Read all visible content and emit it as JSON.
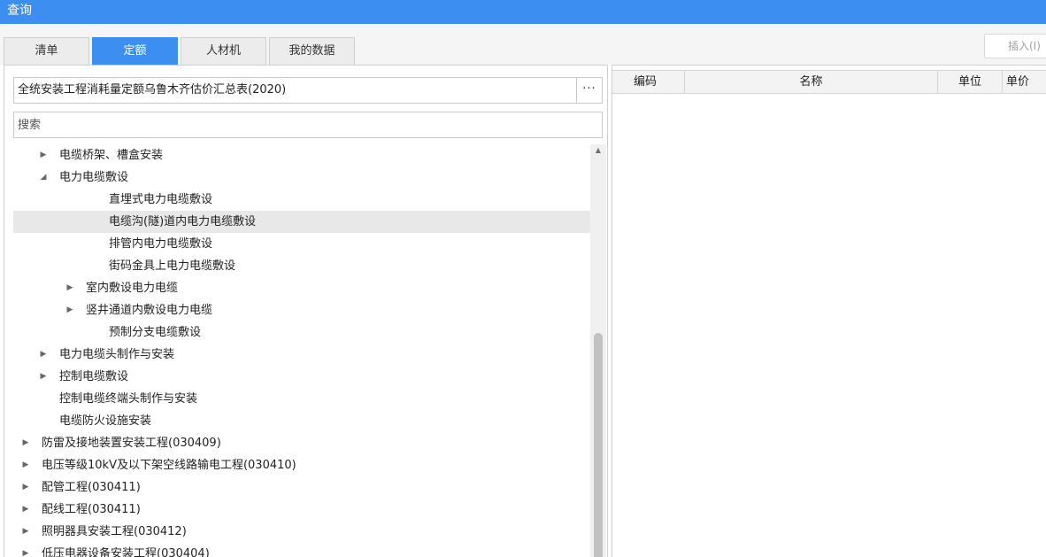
{
  "window": {
    "title": "查询"
  },
  "tabs": [
    {
      "label": "清单",
      "active": false
    },
    {
      "label": "定额",
      "active": true
    },
    {
      "label": "人材机",
      "active": false
    },
    {
      "label": "我的数据",
      "active": false
    }
  ],
  "toolbar": {
    "insert_label": "插入(I)"
  },
  "library": {
    "name": "全统安装工程消耗量定额乌鲁木齐估价汇总表(2020)",
    "more_label": "···"
  },
  "search": {
    "placeholder": "搜索",
    "value": ""
  },
  "tree": [
    {
      "label": "电缆桥架、槽盒安装",
      "level": 2,
      "state": "collapsed",
      "selected": false
    },
    {
      "label": "电力电缆敷设",
      "level": 2,
      "state": "expanded",
      "selected": false
    },
    {
      "label": "直埋式电力电缆敷设",
      "level": 3,
      "state": "leaf",
      "selected": false
    },
    {
      "label": "电缆沟(隧)道内电力电缆敷设",
      "level": 3,
      "state": "leaf",
      "selected": true
    },
    {
      "label": "排管内电力电缆敷设",
      "level": 3,
      "state": "leaf",
      "selected": false
    },
    {
      "label": "街码金具上电力电缆敷设",
      "level": 3,
      "state": "leaf",
      "selected": false
    },
    {
      "label": "室内敷设电力电缆",
      "level": 3,
      "state": "collapsed",
      "selected": false
    },
    {
      "label": "竖井通道内敷设电力电缆",
      "level": 3,
      "state": "collapsed",
      "selected": false
    },
    {
      "label": "预制分支电缆敷设",
      "level": 3,
      "state": "leaf",
      "selected": false
    },
    {
      "label": "电力电缆头制作与安装",
      "level": 2,
      "state": "collapsed",
      "selected": false
    },
    {
      "label": "控制电缆敷设",
      "level": 2,
      "state": "collapsed",
      "selected": false
    },
    {
      "label": "控制电缆终端头制作与安装",
      "level": 2,
      "state": "leaf",
      "selected": false
    },
    {
      "label": "电缆防火设施安装",
      "level": 2,
      "state": "leaf",
      "selected": false
    },
    {
      "label": "防雷及接地装置安装工程(030409)",
      "level": 1,
      "state": "collapsed",
      "selected": false
    },
    {
      "label": "电压等级10kV及以下架空线路输电工程(030410)",
      "level": 1,
      "state": "collapsed",
      "selected": false
    },
    {
      "label": "配管工程(030411)",
      "level": 1,
      "state": "collapsed",
      "selected": false
    },
    {
      "label": "配线工程(030411)",
      "level": 1,
      "state": "collapsed",
      "selected": false
    },
    {
      "label": "照明器具安装工程(030412)",
      "level": 1,
      "state": "collapsed",
      "selected": false
    },
    {
      "label": "低压电器设备安装工程(030404)",
      "level": 1,
      "state": "collapsed",
      "selected": false
    }
  ],
  "grid": {
    "columns": [
      {
        "key": "code",
        "label": "编码"
      },
      {
        "key": "name",
        "label": "名称"
      },
      {
        "key": "unit",
        "label": "单位"
      },
      {
        "key": "price",
        "label": "单价"
      }
    ],
    "rows": []
  }
}
